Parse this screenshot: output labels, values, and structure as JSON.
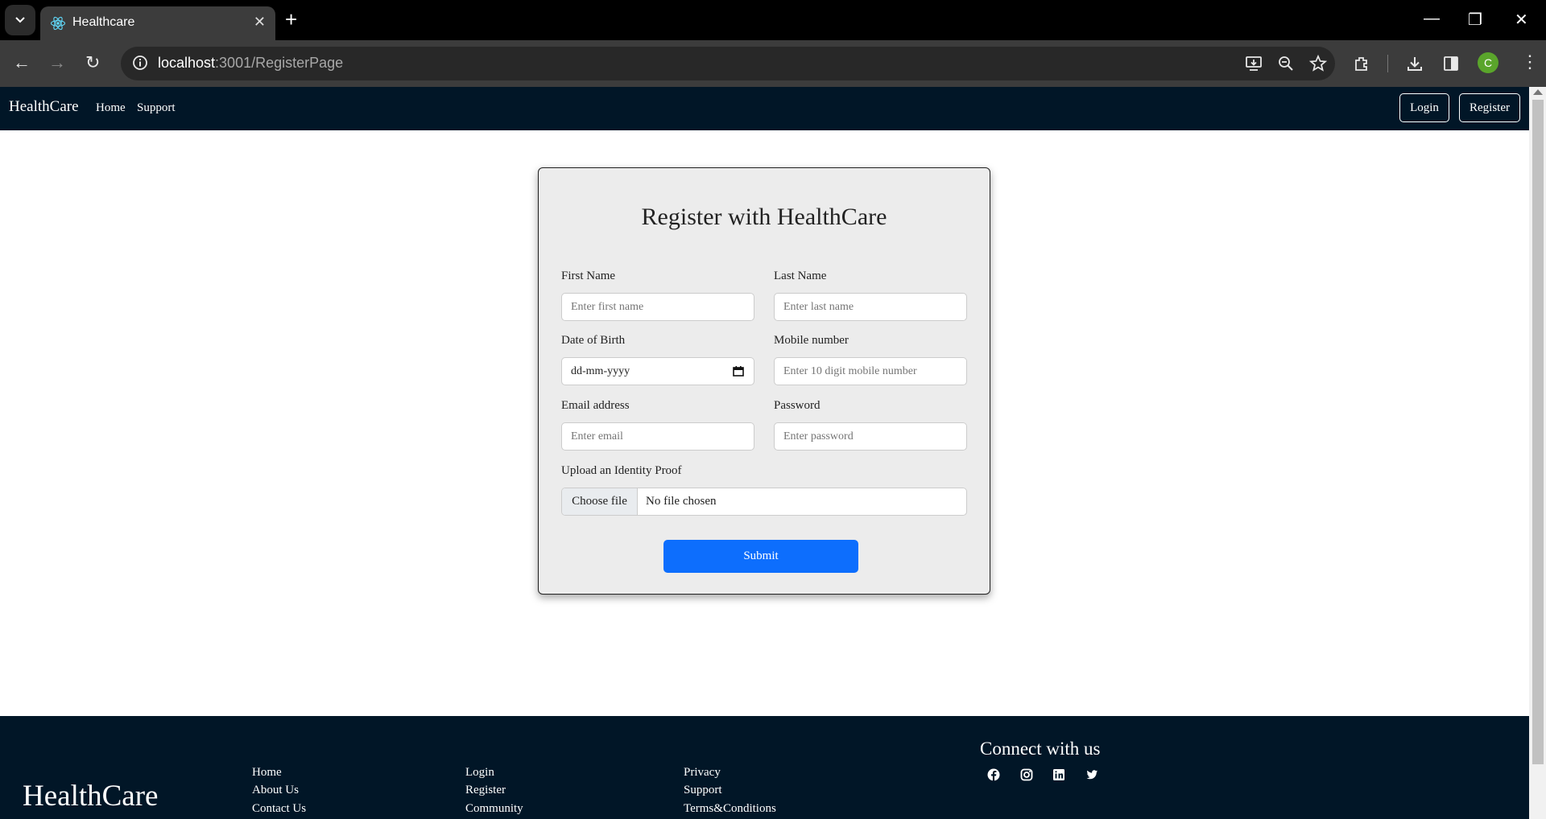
{
  "browser": {
    "tab_title": "Healthcare",
    "tab_close": "✕",
    "new_tab": "+",
    "url_host": "localhost",
    "url_path": ":3001/RegisterPage",
    "profile_initial": "C",
    "window": {
      "minimize": "—",
      "restore": "❐",
      "close": "✕"
    },
    "nav": {
      "back": "←",
      "forward": "→",
      "reload": "↻"
    }
  },
  "navbar": {
    "brand": "HealthCare",
    "links": [
      "Home",
      "Support"
    ],
    "login": "Login",
    "register": "Register"
  },
  "form": {
    "title": "Register with HealthCare",
    "first_name": {
      "label": "First Name",
      "placeholder": "Enter first name"
    },
    "last_name": {
      "label": "Last Name",
      "placeholder": "Enter last name"
    },
    "dob": {
      "label": "Date of Birth",
      "value": "dd-mm-yyyy"
    },
    "mobile": {
      "label": "Mobile number",
      "placeholder": "Enter 10 digit mobile number"
    },
    "email": {
      "label": "Email address",
      "placeholder": "Enter email"
    },
    "password": {
      "label": "Password",
      "placeholder": "Enter password"
    },
    "upload": {
      "label": "Upload an Identity Proof",
      "button": "Choose file",
      "status": "No file chosen"
    },
    "submit": "Submit"
  },
  "footer": {
    "brand": "HealthCare",
    "col1": [
      "Home",
      "About Us",
      "Contact Us"
    ],
    "col2": [
      "Login",
      "Register",
      "Community"
    ],
    "col3": [
      "Privacy",
      "Support",
      "Terms&Conditions"
    ],
    "connect": "Connect with us",
    "social_icons": [
      "facebook-icon",
      "instagram-icon",
      "linkedin-icon",
      "twitter-icon"
    ]
  },
  "colors": {
    "nav_bg": "#011627",
    "submit_bg": "#0d6efd",
    "card_bg": "#ececec"
  }
}
